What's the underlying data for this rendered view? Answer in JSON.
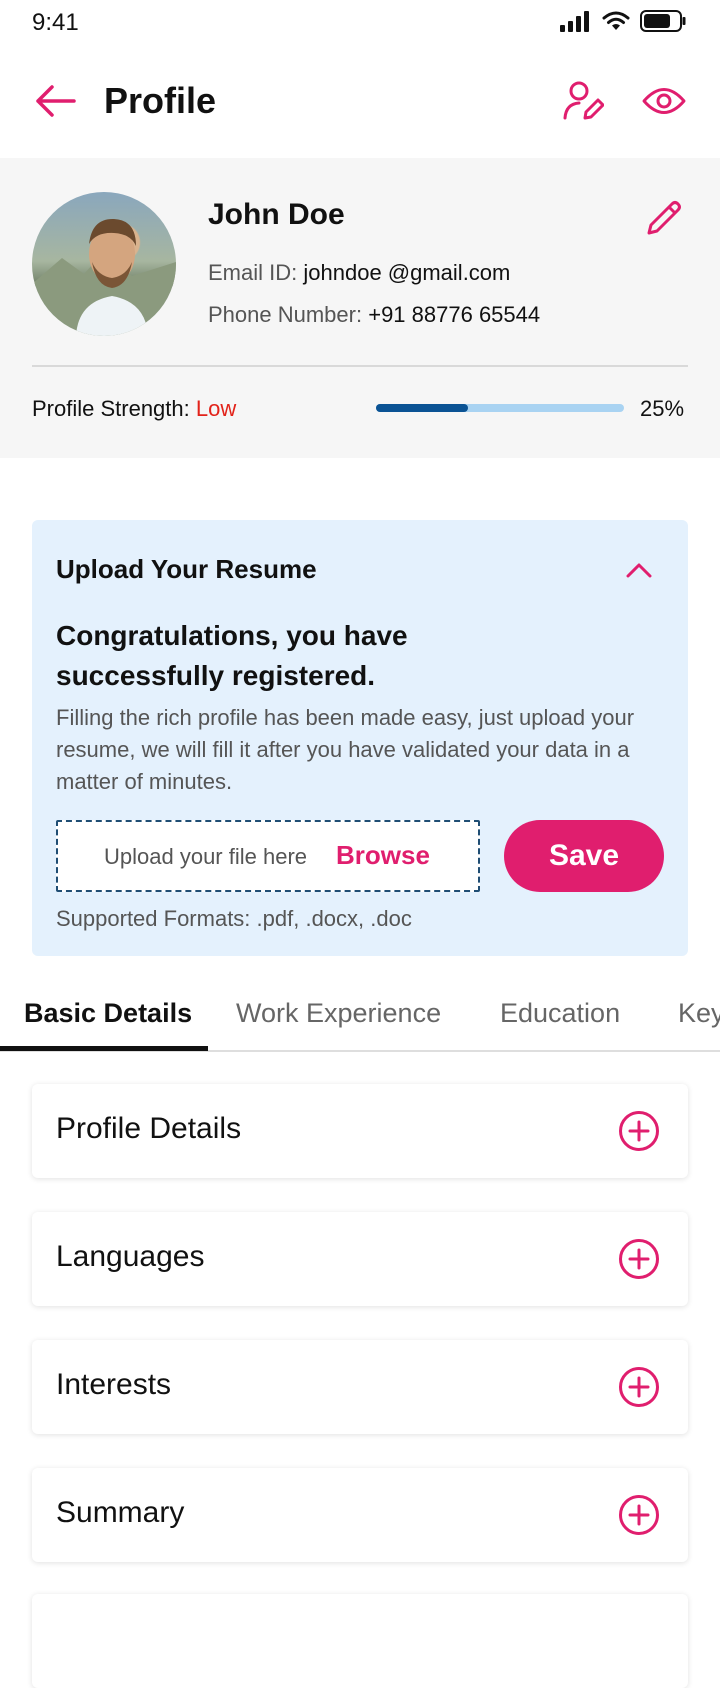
{
  "status_bar": {
    "time": "9:41"
  },
  "header": {
    "title": "Profile"
  },
  "profile": {
    "name": "John Doe",
    "email_label": "Email ID:",
    "email_value": "johndoe @gmail.com",
    "phone_label": "Phone Number:",
    "phone_value": "+91 88776 65544",
    "strength_label": "Profile Strength:",
    "strength_value": "Low",
    "strength_percent_text": "25%",
    "strength_fraction": 0.37
  },
  "upload": {
    "title": "Upload Your Resume",
    "congrats": "Congratulations, you have successfully registered.",
    "description": "Filling the rich profile has been made easy, just upload your resume, we will fill it after you have validated your data in a matter of minutes.",
    "placeholder": "Upload your file here",
    "browse_label": "Browse",
    "save_label": "Save",
    "formats": "Supported Formats: .pdf, .docx, .doc"
  },
  "tabs": [
    {
      "label": "Basic Details",
      "active": true
    },
    {
      "label": "Work Experience",
      "active": false
    },
    {
      "label": "Education",
      "active": false
    },
    {
      "label": "Key",
      "active": false
    }
  ],
  "sections": [
    {
      "label": "Profile Details"
    },
    {
      "label": "Languages"
    },
    {
      "label": "Interests"
    },
    {
      "label": "Summary"
    }
  ],
  "colors": {
    "accent": "#e01e6e",
    "status_low": "#e2231a",
    "progress_fill": "#0b5394",
    "progress_track": "#a9d3f2",
    "upload_bg": "#e4f1fd"
  },
  "icons": {
    "back": "arrow-left-icon",
    "header_action_1": "user-edit-icon",
    "header_action_2": "eye-icon",
    "edit": "pencil-icon",
    "collapse": "chevron-up-icon",
    "add": "plus-circle-icon"
  }
}
